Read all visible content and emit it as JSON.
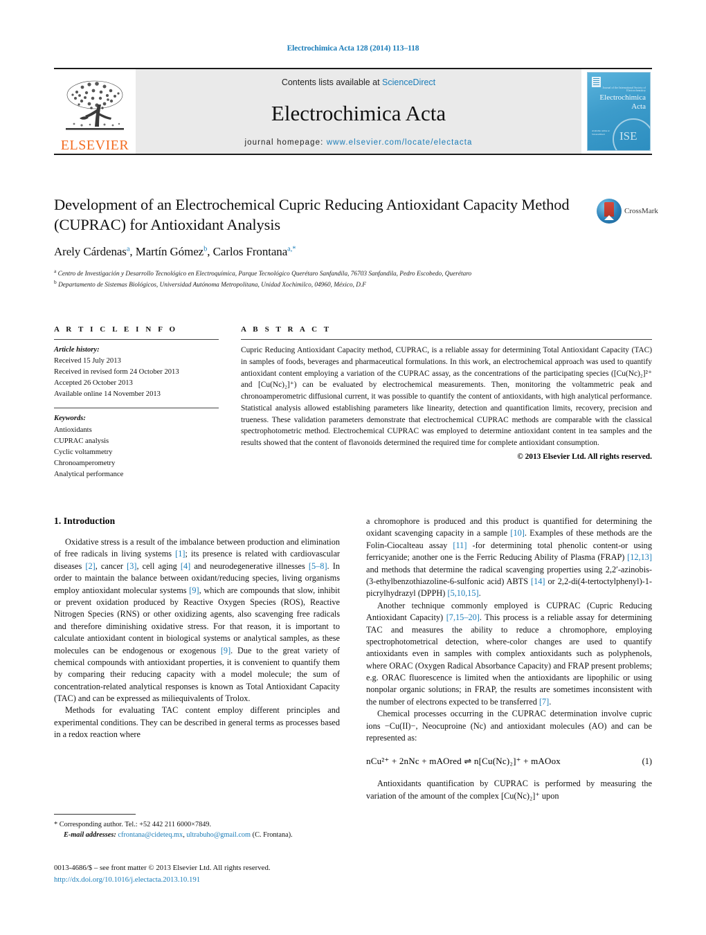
{
  "running_head": "Electrochimica Acta 128 (2014) 113–118",
  "masthead": {
    "publisher_name": "ELSEVIER",
    "contents_prefix": "Contents lists available at ",
    "contents_link": "ScienceDirect",
    "journal_title": "Electrochimica Acta",
    "homepage_prefix": "journal homepage: ",
    "homepage_url": "www.elsevier.com/locate/electacta",
    "cover_title_line1": "Electrochimica",
    "cover_title_line2": "Acta",
    "cover_subtitle": "Journal of the International Society of Electrochemistry",
    "cover_footer": "Available online at ScienceDirect",
    "cover_seal": "ISE"
  },
  "article": {
    "title": "Development of an Electrochemical Cupric Reducing Antioxidant Capacity Method (CUPRAC) for Antioxidant Analysis",
    "authors": [
      {
        "name": "Arely Cárdenas",
        "marks": "a"
      },
      {
        "name": "Martín Gómez",
        "marks": "b"
      },
      {
        "name": "Carlos Frontana",
        "marks": "a,*"
      }
    ],
    "affiliations": [
      {
        "mark": "a",
        "text": "Centro de Investigación y Desarrollo Tecnológico en Electroquímica, Parque Tecnológico Querétaro Sanfandila, 76703 Sanfandila, Pedro Escobedo, Querétaro"
      },
      {
        "mark": "b",
        "text": "Departamento de Sistemas Biológicos, Universidad Autónoma Metropolitana, Unidad Xochimilco, 04960, México, D.F"
      }
    ],
    "crossmark_label": "CrossMark"
  },
  "article_info": {
    "heading": "A R T I C L E   I N F O",
    "history_label": "Article history:",
    "history": [
      "Received 15 July 2013",
      "Received in revised form 24 October 2013",
      "Accepted 26 October 2013",
      "Available online 14 November 2013"
    ],
    "keywords_label": "Keywords:",
    "keywords": [
      "Antioxidants",
      "CUPRAC analysis",
      "Cyclic voltammetry",
      "Chronoamperometry",
      "Analytical performance"
    ]
  },
  "abstract": {
    "heading": "A B S T R A C T",
    "text": "Cupric Reducing Antioxidant Capacity method, CUPRAC, is a reliable assay for determining Total Antioxidant Capacity (TAC) in samples of foods, beverages and pharmaceutical formulations. In this work, an electrochemical approach was used to quantify antioxidant content employing a variation of the CUPRAC assay, as the concentrations of the participating species ([Cu(Nc)₂]²⁺ and [Cu(Nc)₂]⁺) can be evaluated by electrochemical measurements. Then, monitoring the voltammetric peak and chronoamperometric diffusional current, it was possible to quantify the content of antioxidants, with high analytical performance. Statistical analysis allowed establishing parameters like linearity, detection and quantification limits, recovery, precision and trueness. These validation parameters demonstrate that electrochemical CUPRAC methods are comparable with the classical spectrophotometric method. Electrochemical CUPRAC was employed to determine antioxidant content in tea samples and the results showed that the content of flavonoids determined the required time for complete antioxidant consumption.",
    "copyright": "© 2013 Elsevier Ltd. All rights reserved."
  },
  "body": {
    "section_number_title": "1.  Introduction",
    "left_paragraphs": [
      "Oxidative stress is a result of the imbalance between production and elimination of free radicals in living systems [1]; its presence is related with cardiovascular diseases [2], cancer [3], cell aging [4] and neurodegenerative illnesses [5–8]. In order to maintain the balance between oxidant/reducing species, living organisms employ antioxidant molecular systems [9], which are compounds that slow, inhibit or prevent oxidation produced by Reactive Oxygen Species (ROS), Reactive Nitrogen Species (RNS) or other oxidizing agents, also scavenging free radicals and therefore diminishing oxidative stress. For that reason, it is important to calculate antioxidant content in biological systems or analytical samples, as these molecules can be endogenous or exogenous [9]. Due to the great variety of chemical compounds with antioxidant properties, it is convenient to quantify them by comparing their reducing capacity with a model molecule; the sum of concentration-related analytical responses is known as Total Antioxidant Capacity (TAC) and can be expressed as miliequivalents of Trolox.",
      "Methods for evaluating TAC content employ different principles and experimental conditions. They can be described in general terms as processes based in a redox reaction where"
    ],
    "right_paragraphs": [
      "a chromophore is produced and this product is quantified for determining the oxidant scavenging capacity in a sample [10]. Examples of these methods are the Folin-Ciocalteau assay [11] -for determining total phenolic content-or using ferricyanide; another one is the Ferric Reducing Ability of Plasma (FRAP) [12,13] and methods that determine the radical scavenging properties using 2,2′-azinobis-(3-ethylbenzothiazoline-6-sulfonic acid) ABTS [14] or 2,2-di(4-tertoctylphenyl)-1-picrylhydrazyl (DPPH) [5,10,15].",
      "Another technique commonly employed is CUPRAC (Cupric Reducing Antioxidant Capacity) [7,15–20]. This process is a reliable assay for determining TAC and measures the ability to reduce a chromophore, employing spectrophotometrical detection, where-color changes are used to quantify antioxidants even in samples with complex antioxidants such as polyphenols, where ORAC (Oxygen Radical Absorbance Capacity) and FRAP present problems; e.g. ORAC fluorescence is limited when the antioxidants are lipophilic or using nonpolar organic solutions; in FRAP, the results are sometimes inconsistent with the number of electrons expected to be transferred [7].",
      "Chemical processes occurring in the CUPRAC determination involve cupric ions −Cu(II)−, Neocuproine (Nc) and antioxidant molecules (AO) and can be represented as:",
      "Antioxidants quantification by CUPRAC is performed by measuring the variation of the amount of the complex [Cu(Nc)₂]⁺ upon"
    ],
    "equation": {
      "text": "nCu²⁺ + 2nNc + mAOred ⇌ n[Cu(Nc)₂]⁺ + mAOox",
      "number": "(1)"
    }
  },
  "footnote": {
    "corresponding": "* Corresponding author. Tel.: +52 442 211 6000×7849.",
    "email_label": "E-mail addresses:",
    "emails": [
      "cfrontana@cideteq.mx",
      "ultrabuho@gmail.com"
    ],
    "email_suffix": "(C. Frontana)."
  },
  "footer": {
    "issn_line": "0013-4686/$ – see front matter © 2013 Elsevier Ltd. All rights reserved.",
    "doi": "http://dx.doi.org/10.1016/j.electacta.2013.10.191"
  },
  "colors": {
    "link_blue": "#1a7cb8",
    "elsevier_orange": "#F36C21",
    "panel_grey": "#eaeaea"
  }
}
